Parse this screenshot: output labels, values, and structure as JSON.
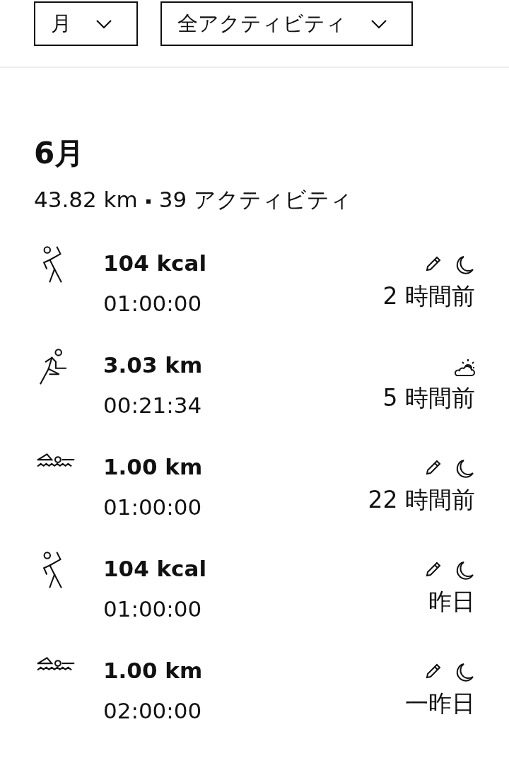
{
  "filters": [
    {
      "label": "月"
    },
    {
      "label": "全アクティビティ"
    }
  ],
  "month": {
    "title": "6月",
    "distance": "43.82 km",
    "count": "39 アクティビティ"
  },
  "activities": [
    {
      "kind": "dance",
      "primary": "104 kcal",
      "duration": "01:00:00",
      "when": "2 時間前",
      "edited": true,
      "weather": {
        "kind": "night"
      }
    },
    {
      "kind": "run",
      "primary": "3.03 km",
      "duration": "00:21:34",
      "when": "5 時間前",
      "edited": false,
      "weather": {
        "kind": "partly-cloudy"
      }
    },
    {
      "kind": "swim",
      "primary": "1.00 km",
      "duration": "01:00:00",
      "when": "22 時間前",
      "edited": true,
      "weather": {
        "kind": "night"
      }
    },
    {
      "kind": "dance",
      "primary": "104 kcal",
      "duration": "01:00:00",
      "when": "昨日",
      "edited": true,
      "weather": {
        "kind": "night"
      }
    },
    {
      "kind": "swim",
      "primary": "1.00 km",
      "duration": "02:00:00",
      "when": "一昨日",
      "edited": true,
      "weather": {
        "kind": "night"
      }
    }
  ]
}
